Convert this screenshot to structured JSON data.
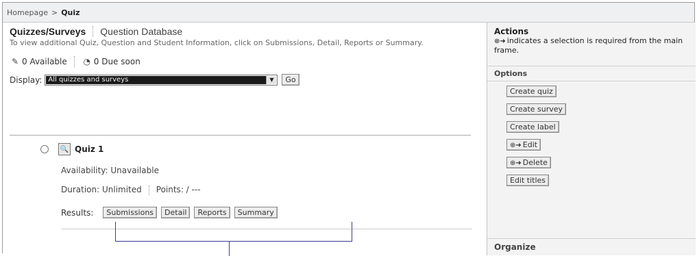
{
  "breadcrumb": {
    "home": "Homepage",
    "separator": ">",
    "current": "Quiz"
  },
  "tabs": {
    "active": "Quizzes/Surveys",
    "other": "Question Database"
  },
  "intro_text": "To view additional Quiz, Question and Student Information, click on Submissions, Detail, Reports or Summary.",
  "stats": {
    "available_icon": "pencil-icon",
    "available": "0 Available",
    "due_icon": "clock-icon",
    "due": "0 Due soon"
  },
  "display": {
    "label": "Display:",
    "selected": "All quizzes and surveys",
    "go_label": "Go"
  },
  "quiz": {
    "title": "Quiz 1",
    "availability": "Availability: Unavailable",
    "duration": "Duration: Unlimited",
    "points": "Points: / ---",
    "results_label": "Results:",
    "buttons": {
      "submissions": "Submissions",
      "detail": "Detail",
      "reports": "Reports",
      "summary": "Summary"
    }
  },
  "sidebar": {
    "actions_title": "Actions",
    "actions_note": "indicates a selection is required from the main frame.",
    "options_title": "Options",
    "options": {
      "create_quiz": "Create quiz",
      "create_survey": "Create survey",
      "create_label": "Create label",
      "edit": "Edit",
      "delete": "Delete",
      "edit_titles": "Edit titles"
    },
    "organize_title": "Organize"
  },
  "colors": {
    "callout": "#3b3b8f",
    "breadcrumb_bg": "#eef0f2",
    "sidebar_bg": "#f3f3f3"
  }
}
